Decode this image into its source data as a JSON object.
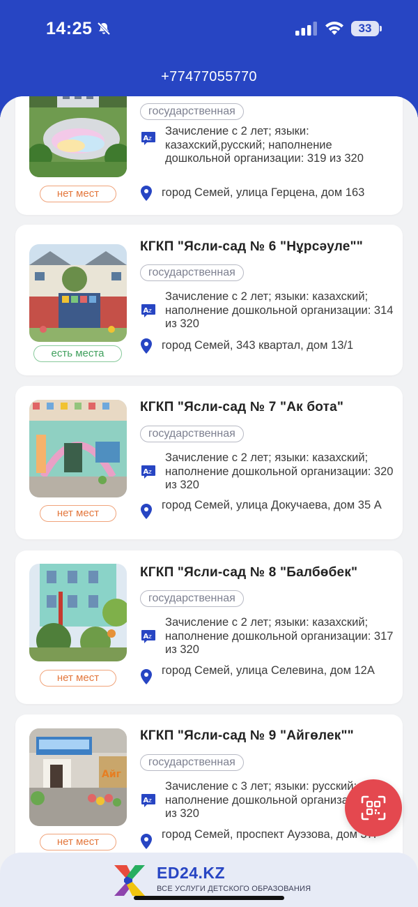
{
  "status_bar": {
    "time": "14:25",
    "battery": "33"
  },
  "header": {
    "phone": "+77477055770"
  },
  "items": [
    {
      "title": "",
      "type": "государственная",
      "info": "Зачисление с 2 лет; языки: казахский,русский; наполнение дошкольной организации: 319 из 320",
      "address": "город Семей, улица Герцена, дом 163",
      "availability": "нет мест"
    },
    {
      "title": "КГКП \"Ясли-сад № 6 \"Нұрсәуле\"\"",
      "type": "государственная",
      "info": "Зачисление с 2 лет; языки: казахский; наполнение дошкольной организации: 314 из 320",
      "address": "город Семей, 343 квартал, дом 13/1",
      "availability": "есть места"
    },
    {
      "title": "КГКП \"Ясли-сад № 7 \"Ак бота\"",
      "type": "государственная",
      "info": "Зачисление с 2 лет; языки: казахский; наполнение дошкольной организации: 320 из 320",
      "address": "город Семей, улица Докучаева, дом 35 А",
      "availability": "нет мест"
    },
    {
      "title": "КГКП \"Ясли-сад № 8 \"Балбөбек\"",
      "type": "государственная",
      "info": "Зачисление с 2 лет; языки: казахский; наполнение дошкольной организации: 317 из 320",
      "address": "город Семей, улица Селевина, дом 12А",
      "availability": "нет мест"
    },
    {
      "title": "КГКП \"Ясли-сад № 9 \"Айгөлек\"\"",
      "type": "государственная",
      "info": "Зачисление с 3 лет; языки: русский; наполнение дошкольной организации: 301 из 320",
      "address": "город Семей, проспект Ауэзова, дом 37Г",
      "availability": "нет мест"
    }
  ],
  "footer": {
    "brand": "ED24.KZ",
    "tagline": "ВСЕ УСЛУГИ ДЕТСКОГО ОБРАЗОВАНИЯ"
  },
  "colors": {
    "primary": "#2745c3",
    "no_places": "#e3773d",
    "has_places": "#3f9f5c",
    "fab": "#e4484f"
  },
  "icons": {
    "language": "translate-icon",
    "location": "location-pin-icon",
    "scanner": "qr-scan-icon"
  }
}
